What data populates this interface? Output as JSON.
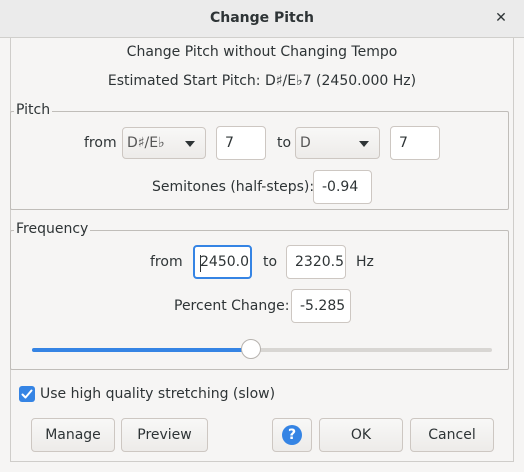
{
  "window": {
    "title": "Change Pitch",
    "close_glyph": "✕"
  },
  "header": {
    "subtitle": "Change Pitch without Changing Tempo",
    "estimated_start_pitch": "Estimated Start Pitch: D♯/E♭7 (2450.000 Hz)"
  },
  "pitch": {
    "group_label": "Pitch",
    "from_label": "from",
    "from_note": "D♯/E♭",
    "from_octave": "7",
    "to_label": "to",
    "to_note": "D",
    "to_octave": "7",
    "semitones_label": "Semitones (half-steps):",
    "semitones_value": "-0.94"
  },
  "frequency": {
    "group_label": "Frequency",
    "from_label": "from",
    "from_value": "2450.0",
    "to_label": "to",
    "to_value": "2320.5",
    "unit": "Hz",
    "percent_label": "Percent Change:",
    "percent_value": "-5.285",
    "slider_fraction": 0.475
  },
  "options": {
    "high_quality_label": "Use high quality stretching (slow)",
    "high_quality_checked": true
  },
  "buttons": {
    "manage": "Manage",
    "preview": "Preview",
    "help_glyph": "?",
    "ok": "OK",
    "cancel": "Cancel"
  },
  "colors": {
    "accent": "#3584e4"
  },
  "icons": {
    "close": "close-icon",
    "help": "help-icon",
    "dropdown": "chevron-down-icon",
    "check": "check-icon"
  }
}
